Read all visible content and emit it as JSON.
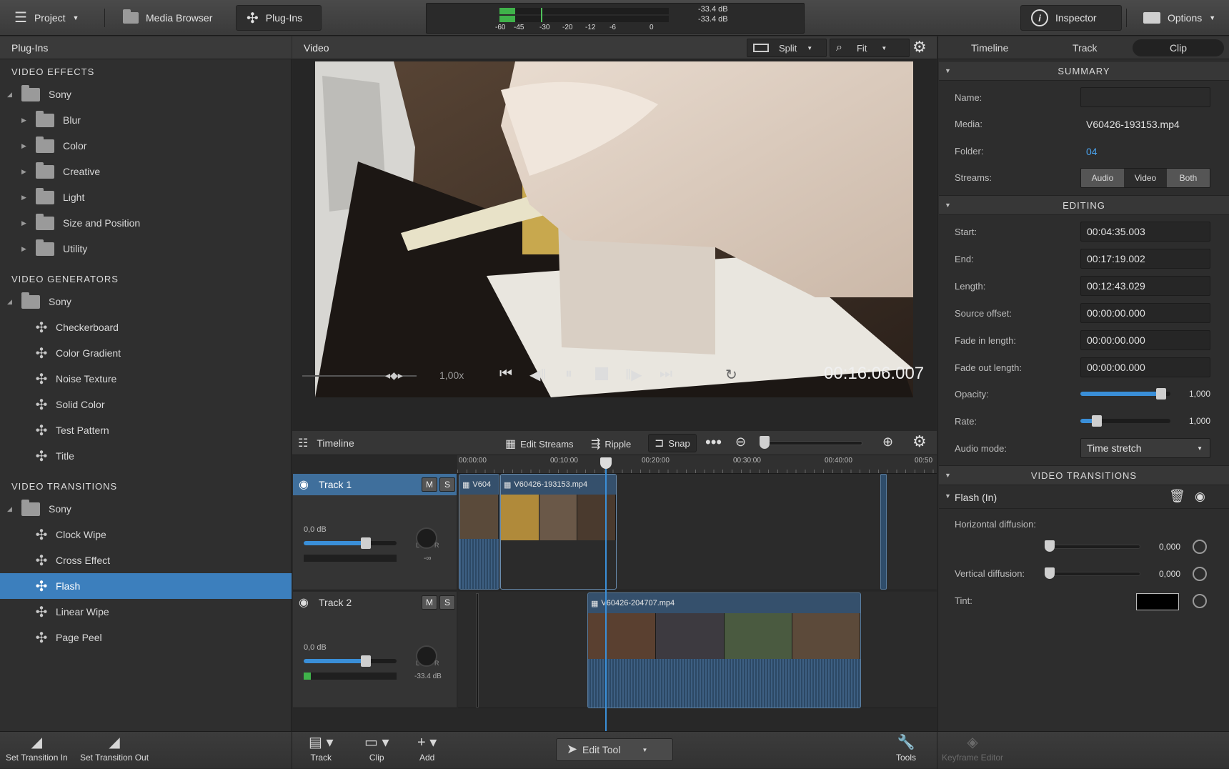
{
  "topbar": {
    "project_label": "Project",
    "media_browser_label": "Media Browser",
    "plugins_label": "Plug-Ins",
    "meter_db_top": "-33.4 dB",
    "meter_db_bottom": "-33.4 dB",
    "meter_ticks": [
      "-60",
      "-45",
      "-30",
      "-20",
      "-12",
      "-6",
      "0"
    ],
    "inspector_label": "Inspector",
    "options_label": "Options"
  },
  "plugins_panel": {
    "title": "Plug-Ins",
    "video_effects": {
      "heading": "VIDEO EFFECTS",
      "vendor": "Sony",
      "items": [
        "Blur",
        "Color",
        "Creative",
        "Light",
        "Size and Position",
        "Utility"
      ]
    },
    "video_generators": {
      "heading": "VIDEO GENERATORS",
      "vendor": "Sony",
      "items": [
        "Checkerboard",
        "Color Gradient",
        "Noise Texture",
        "Solid Color",
        "Test Pattern",
        "Title"
      ]
    },
    "video_transitions": {
      "heading": "VIDEO TRANSITIONS",
      "vendor": "Sony",
      "items": [
        "Clock Wipe",
        "Cross Effect",
        "Flash",
        "Linear Wipe",
        "Page Peel"
      ],
      "selected": "Flash"
    }
  },
  "video_panel": {
    "title": "Video",
    "split_label": "Split",
    "fit_label": "Fit",
    "speed": "1,00x",
    "timecode": "00:16:06.007"
  },
  "timeline": {
    "title": "Timeline",
    "edit_streams_label": "Edit Streams",
    "ripple_label": "Ripple",
    "snap_label": "Snap",
    "ruler_ticks": [
      "00:00:00",
      "00:10:00",
      "00:20:00",
      "00:30:00",
      "00:40:00",
      "00:50"
    ],
    "tracks": [
      {
        "name": "Track 1",
        "gain": "0,0 dB",
        "pan_value": "-∞",
        "clips": [
          "V604",
          "V60426-193153.mp4"
        ]
      },
      {
        "name": "Track 2",
        "gain": "0,0 dB",
        "pan_value": "-33.4 dB",
        "clips": [
          "V60426-204707.mp4"
        ]
      }
    ],
    "mute_label": "M",
    "solo_label": "S",
    "pan_l": "L",
    "pan_r": "R"
  },
  "inspector": {
    "tabs": [
      "Timeline",
      "Track",
      "Clip"
    ],
    "active_tab": "Clip",
    "summary_heading": "SUMMARY",
    "name_label": "Name:",
    "name_value": "",
    "media_label": "Media:",
    "media_value": "V60426-193153.mp4",
    "folder_label": "Folder:",
    "folder_value": "04",
    "streams_label": "Streams:",
    "streams_options": [
      "Audio",
      "Video",
      "Both"
    ],
    "editing_heading": "EDITING",
    "start_label": "Start:",
    "start_value": "00:04:35.003",
    "end_label": "End:",
    "end_value": "00:17:19.002",
    "length_label": "Length:",
    "length_value": "00:12:43.029",
    "source_offset_label": "Source offset:",
    "source_offset_value": "00:00:00.000",
    "fade_in_label": "Fade in length:",
    "fade_in_value": "00:00:00.000",
    "fade_out_label": "Fade out length:",
    "fade_out_value": "00:00:00.000",
    "opacity_label": "Opacity:",
    "opacity_value": "1,000",
    "opacity_fraction": 0.9,
    "rate_label": "Rate:",
    "rate_value": "1,000",
    "rate_fraction": 0.18,
    "audio_mode_label": "Audio mode:",
    "audio_mode_value": "Time stretch",
    "transitions_heading": "VIDEO TRANSITIONS",
    "transition_name": "Flash (In)",
    "h_diffusion_label": "Horizontal diffusion:",
    "h_diffusion_value": "0,000",
    "v_diffusion_label": "Vertical diffusion:",
    "v_diffusion_value": "0,000",
    "tint_label": "Tint:",
    "tint_color": "#000000"
  },
  "bottombar": {
    "set_in_label": "Set Transition In",
    "set_out_label": "Set Transition Out",
    "track_label": "Track",
    "clip_label": "Clip",
    "add_label": "Add",
    "edit_tool_label": "Edit Tool",
    "tools_label": "Tools",
    "keyframe_label": "Keyframe Editor"
  },
  "colors": {
    "accent": "#3c7fbd",
    "clip_blue": "#2f4d6b",
    "meter_green": "#3fb24a"
  }
}
